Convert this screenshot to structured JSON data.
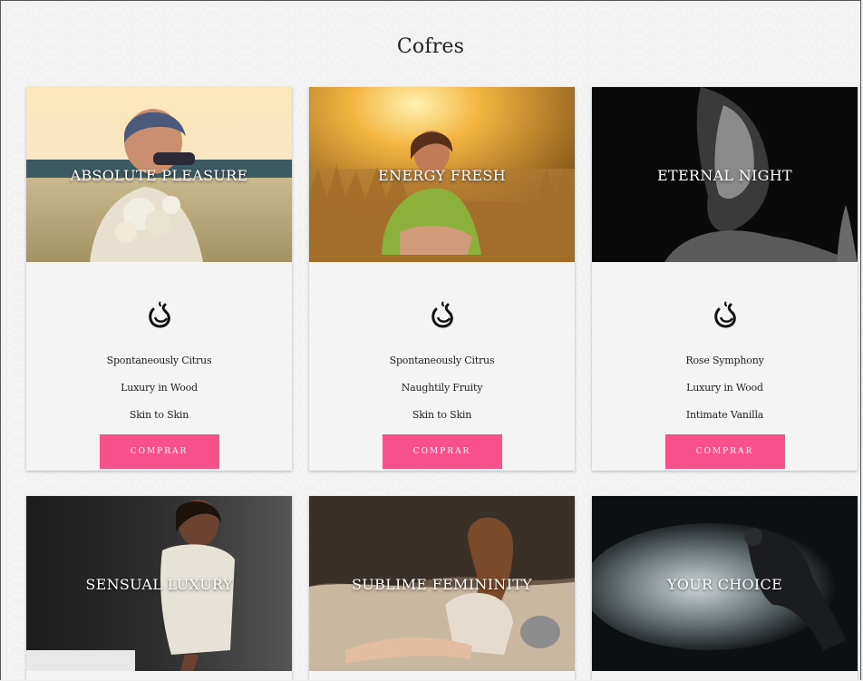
{
  "page": {
    "title": "Cofres"
  },
  "products": [
    {
      "name": "ABSOLUTE PLEASURE",
      "items": [
        "Spontaneously Citrus",
        "Luxury in Wood",
        "Skin to Skin"
      ],
      "button": "COMPRAR",
      "image": "woman-sunglasses-flowers-field"
    },
    {
      "name": "ENERGY FRESH",
      "items": [
        "Spontaneously Citrus",
        "Naughtily Fruity",
        "Skin to Skin"
      ],
      "button": "COMPRAR",
      "image": "woman-sitting-golden-grass"
    },
    {
      "name": "ETERNAL NIGHT",
      "items": [
        "Rose Symphony",
        "Luxury in Wood",
        "Intimate Vanilla"
      ],
      "button": "COMPRAR",
      "image": "woman-dark-portrait"
    },
    {
      "name": "SENSUAL LUXURY",
      "image": "woman-white-knit-dress"
    },
    {
      "name": "SUBLIME FEMININITY",
      "image": "woman-sitting-beach-rocks"
    },
    {
      "name": "YOUR CHOICE",
      "image": "dancer-dust-explosion"
    }
  ],
  "colors": {
    "accent": "#f7508a",
    "card": "#f4f4f4",
    "background": "#f2f2f2"
  },
  "icons": {
    "brand": "perfume-drop-swirl-icon"
  }
}
